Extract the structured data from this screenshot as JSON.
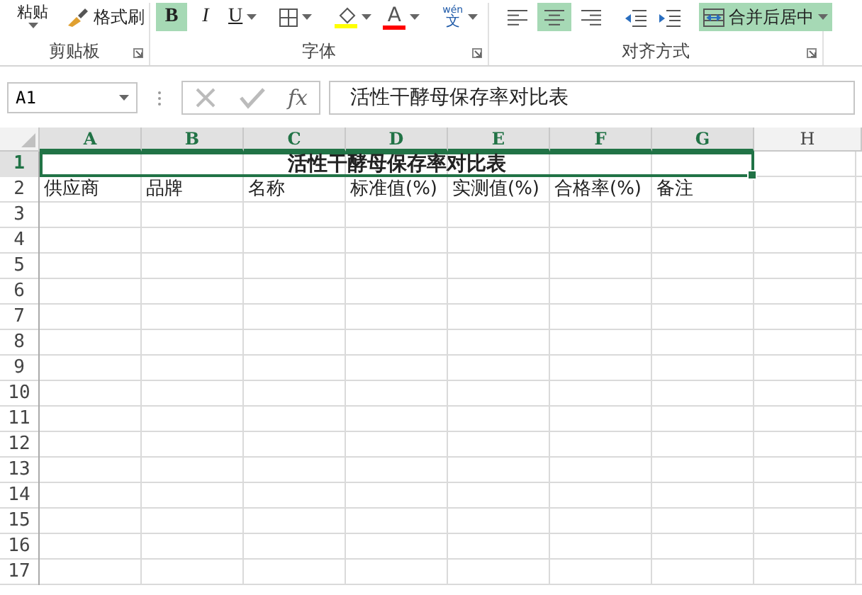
{
  "ribbon": {
    "groups": [
      {
        "label": "剪贴板",
        "launcher": true,
        "tools": [
          {
            "kind": "paste",
            "label": "粘贴",
            "selected": false
          },
          {
            "kind": "format-painter",
            "label": "格式刷",
            "selected": false
          }
        ]
      },
      {
        "label": "字体",
        "launcher": true,
        "tools": [
          {
            "kind": "glyph",
            "label": "B",
            "selected": true,
            "dropdown": false
          },
          {
            "kind": "glyph",
            "label": "I",
            "selected": false,
            "dropdown": false
          },
          {
            "kind": "glyph",
            "label": "U",
            "selected": false,
            "dropdown": true
          },
          {
            "kind": "borders",
            "selected": false,
            "dropdown": true
          },
          {
            "kind": "fill-color",
            "color": "#ffff00",
            "selected": false,
            "dropdown": true
          },
          {
            "kind": "font-color",
            "label": "A",
            "color": "#ff0000",
            "selected": false,
            "dropdown": true
          },
          {
            "kind": "phonetic",
            "label_top": "wén",
            "label": "文",
            "selected": false,
            "dropdown": true
          }
        ]
      },
      {
        "label": "对齐方式",
        "launcher": true,
        "tools": [
          {
            "kind": "align-left",
            "selected": false
          },
          {
            "kind": "align-center",
            "selected": true
          },
          {
            "kind": "align-right",
            "selected": false
          },
          {
            "kind": "indent-decrease",
            "selected": false
          },
          {
            "kind": "indent-increase",
            "selected": false
          },
          {
            "kind": "merge",
            "label": "合并后居中",
            "selected": true,
            "dropdown": true
          }
        ]
      }
    ]
  },
  "formula_bar": {
    "name_box": "A1",
    "function_label": "fx",
    "formula": "活性干酵母保存率对比表"
  },
  "sheet": {
    "columns": [
      {
        "label": "A",
        "selected": true
      },
      {
        "label": "B",
        "selected": true
      },
      {
        "label": "C",
        "selected": true
      },
      {
        "label": "D",
        "selected": true
      },
      {
        "label": "E",
        "selected": true
      },
      {
        "label": "F",
        "selected": true
      },
      {
        "label": "G",
        "selected": true
      },
      {
        "label": "H",
        "selected": false
      }
    ],
    "rows": [
      {
        "label": "1",
        "selected": true,
        "title": "活性干酵母保存率对比表"
      },
      {
        "label": "2",
        "selected": false,
        "cells": [
          "供应商",
          "品牌",
          "名称",
          "标准值(%)",
          "实测值(%)",
          "合格率(%)",
          "备注"
        ]
      },
      {
        "label": "3",
        "selected": false
      },
      {
        "label": "4",
        "selected": false
      },
      {
        "label": "5",
        "selected": false
      },
      {
        "label": "6",
        "selected": false
      },
      {
        "label": "7",
        "selected": false
      },
      {
        "label": "8",
        "selected": false
      },
      {
        "label": "9",
        "selected": false
      },
      {
        "label": "10",
        "selected": false
      },
      {
        "label": "11",
        "selected": false
      },
      {
        "label": "12",
        "selected": false
      },
      {
        "label": "13",
        "selected": false
      },
      {
        "label": "14",
        "selected": false
      },
      {
        "label": "15",
        "selected": false
      },
      {
        "label": "16",
        "selected": false
      },
      {
        "label": "17",
        "selected": false
      }
    ]
  }
}
